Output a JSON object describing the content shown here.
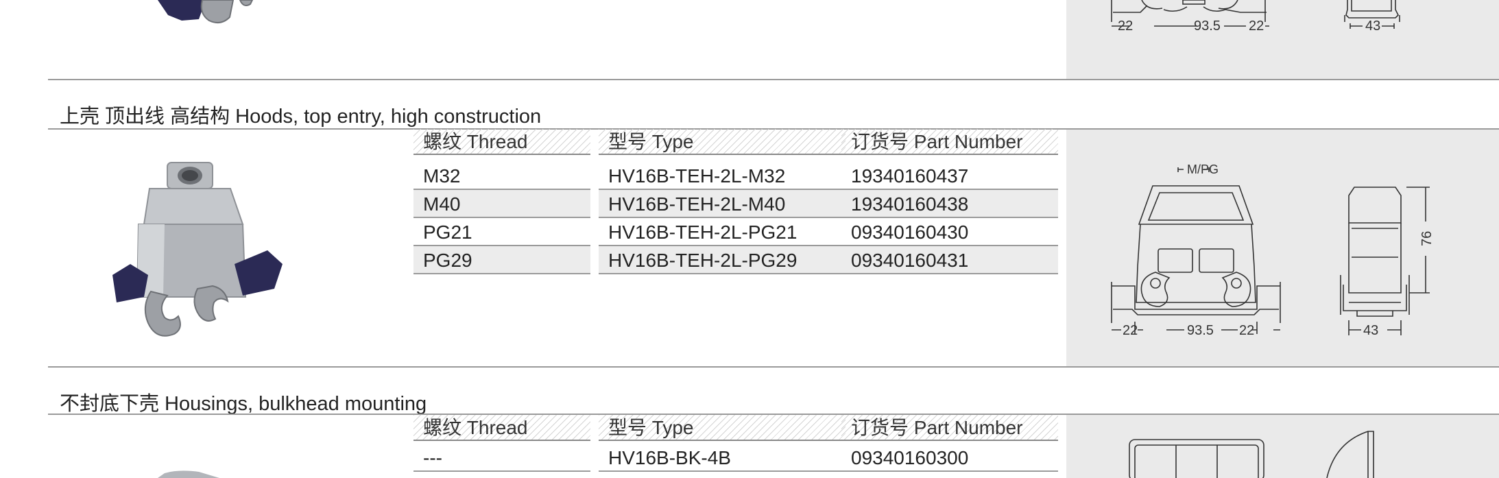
{
  "sections": [
    {
      "title": "上壳 顶出线 高结构 Hoods, top entry, high construction",
      "table": {
        "headers": [
          "螺纹 Thread",
          "型号 Type",
          "订货号 Part Number"
        ],
        "rows": [
          [
            "M32",
            "HV16B-TEH-2L-M32",
            "19340160437"
          ],
          [
            "M40",
            "HV16B-TEH-2L-M40",
            "19340160438"
          ],
          [
            "PG21",
            "HV16B-TEH-2L-PG21",
            "09340160430"
          ],
          [
            "PG29",
            "HV16B-TEH-2L-PG29",
            "09340160431"
          ]
        ]
      },
      "drawing": {
        "top_label": "M/PG",
        "dim_left": "22",
        "dim_mid": "93.5",
        "dim_right": "22",
        "dim_side": "43",
        "dim_height": "76"
      }
    },
    {
      "title": "不封底下壳 Housings, bulkhead mounting",
      "table": {
        "headers": [
          "螺纹 Thread",
          "型号 Type",
          "订货号 Part Number"
        ],
        "rows": [
          [
            "---",
            "HV16B-BK-4B",
            "09340160300"
          ]
        ]
      }
    }
  ],
  "top_drawing": {
    "dim_left": "22",
    "dim_mid": "93.5",
    "dim_right": "22",
    "dim_side": "43"
  },
  "colors": {
    "panel": "#eaeaea",
    "rule": "#9a9a9a",
    "housing": "#b9bcc0",
    "latch": "#2b2a55"
  }
}
